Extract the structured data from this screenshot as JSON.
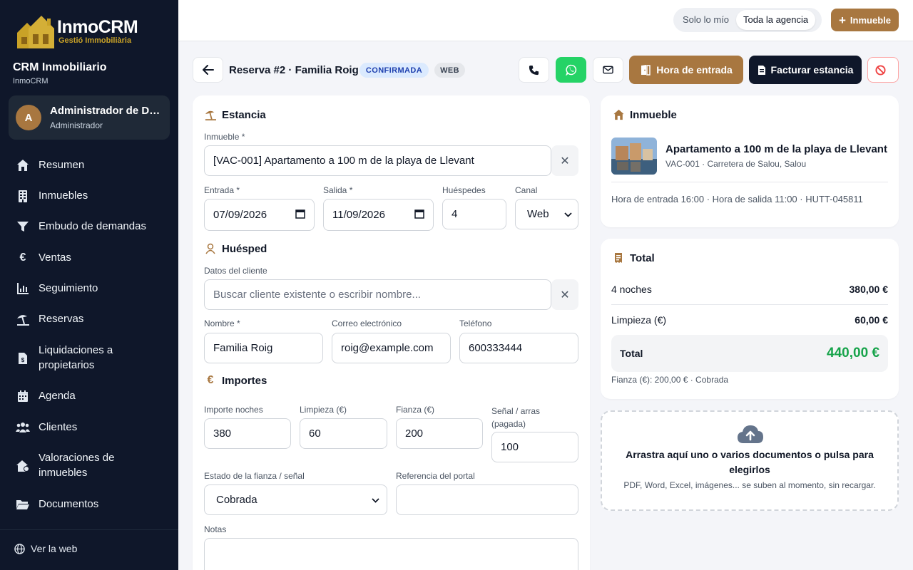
{
  "brand": {
    "name": "InmoCRM",
    "tagline": "Gestió Immobiliària"
  },
  "workspace": {
    "title": "CRM Inmobiliario",
    "subtitle": "InmoCRM"
  },
  "user": {
    "initial": "A",
    "name": "Administrador de Demo",
    "role": "Administrador"
  },
  "sidebar": {
    "items": [
      {
        "label": "Resumen",
        "icon": "home-icon"
      },
      {
        "label": "Inmuebles",
        "icon": "building-icon"
      },
      {
        "label": "Embudo de demandas",
        "icon": "funnel-icon"
      },
      {
        "label": "Ventas",
        "icon": "euro-icon"
      },
      {
        "label": "Seguimiento",
        "icon": "chart-icon"
      },
      {
        "label": "Reservas",
        "icon": "umbrella-beach-icon"
      },
      {
        "label": "Liquidaciones a propietarios",
        "icon": "invoice-icon"
      },
      {
        "label": "Agenda",
        "icon": "calendar-icon"
      },
      {
        "label": "Clientes",
        "icon": "users-icon"
      },
      {
        "label": "Valoraciones de inmuebles",
        "icon": "house-valuation-icon"
      },
      {
        "label": "Documentos",
        "icon": "folder-icon"
      }
    ],
    "footer": {
      "label": "Ver la web",
      "icon": "globe-icon"
    }
  },
  "topbar": {
    "scope_options": [
      "Solo lo mío",
      "Toda la agencia"
    ],
    "scope_selected": "Toda la agencia",
    "add_button": "Inmueble"
  },
  "header": {
    "title": "Reserva #2 · Familia Roig",
    "status_badge": "CONFIRMADA",
    "channel_badge": "WEB",
    "checkin_button": "Hora de entrada",
    "invoice_button": "Facturar estancia"
  },
  "form": {
    "stay_section": "Estancia",
    "property_label": "Inmueble *",
    "property_value": "[VAC-001] Apartamento a 100 m de la playa de Llevant",
    "checkin_label": "Entrada *",
    "checkin_value": "07/09/2026",
    "checkout_label": "Salida *",
    "checkout_value": "11/09/2026",
    "guests_label": "Huéspedes",
    "guests_value": "4",
    "channel_label": "Canal",
    "channel_value": "Web",
    "guest_section": "Huésped",
    "client_label": "Datos del cliente",
    "client_placeholder": "Buscar cliente existente o escribir nombre...",
    "name_label": "Nombre *",
    "name_value": "Familia Roig",
    "email_label": "Correo electrónico",
    "email_value": "roig@example.com",
    "phone_label": "Teléfono",
    "phone_value": "600333444",
    "amounts_section": "Importes",
    "nights_amount_label": "Importe noches",
    "nights_amount_value": "380",
    "cleaning_label": "Limpieza (€)",
    "cleaning_value": "60",
    "deposit_label": "Fianza (€)",
    "deposit_value": "200",
    "downpayment_label": "Señal / arras (pagada)",
    "downpayment_value": "100",
    "deposit_status_label": "Estado de la fianza / señal",
    "deposit_status_value": "Cobrada",
    "portal_ref_label": "Referencia del portal",
    "portal_ref_value": "",
    "notes_label": "Notas",
    "notes_value": ""
  },
  "property_card": {
    "title": "Inmueble",
    "name": "Apartamento a 100 m de la playa de Llevant",
    "subtitle": "VAC-001 · Carretera de Salou, Salou",
    "meta": "Hora de entrada 16:00 · Hora de salida 11:00 · HUTT-045811"
  },
  "total_card": {
    "title": "Total",
    "rows": [
      {
        "label": "4 noches",
        "value": "380,00 €"
      },
      {
        "label": "Limpieza (€)",
        "value": "60,00 €"
      }
    ],
    "total_label": "Total",
    "total_value": "440,00 €",
    "deposit_note": "Fianza (€): 200,00 € · Cobrada"
  },
  "dropzone": {
    "title": "Arrastra aquí uno o varios documentos o pulsa para elegirlos",
    "subtitle": "PDF, Word, Excel, imágenes... se suben al momento, sin recargar."
  },
  "colors": {
    "accent": "#a87740",
    "sidebar": "#0f172a",
    "success": "#16a34a",
    "whatsapp": "#25d366",
    "danger": "#ef4444"
  }
}
